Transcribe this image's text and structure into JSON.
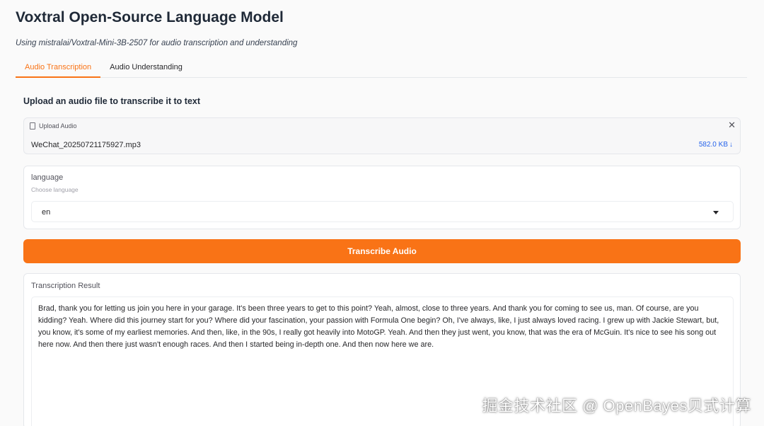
{
  "header": {
    "title": "Voxtral Open-Source Language Model",
    "subtitle": "Using mistralai/Voxtral-Mini-3B-2507 for audio transcription and understanding"
  },
  "tabs": [
    {
      "label": "Audio Transcription",
      "active": true
    },
    {
      "label": "Audio Understanding",
      "active": false
    }
  ],
  "main": {
    "section_label": "Upload an audio file to transcribe it to text",
    "upload": {
      "label": "Upload Audio",
      "file_name": "WeChat_20250721175927.mp3",
      "file_size": "582.0 KB",
      "download_icon": "↓"
    },
    "language": {
      "label": "language",
      "info": "Choose language",
      "selected": "en"
    },
    "button_label": "Transcribe Audio",
    "result": {
      "label": "Transcription Result",
      "text": "Brad, thank you for letting us join you here in your garage. It's been three years to get to this point? Yeah, almost, close to three years. And thank you for coming to see us, man. Of course, are you kidding? Yeah. Where did this journey start for you? Where did your fascination, your passion with Formula One begin? Oh, I've always, like, I just always loved racing. I grew up with Jackie Stewart, but, you know, it's some of my earliest memories. And then, like, in the 90s, I really got heavily into MotoGP. Yeah. And then they just went, you know, that was the era of McGuin. It's nice to see his song out here now. And then there just wasn't enough races. And then I started being in-depth one. And then now here we are."
    }
  },
  "watermark": "掘金技术社区 @ OpenBayes贝式计算",
  "colors": {
    "accent": "#f97316",
    "link": "#2563eb",
    "background": "#fafafa"
  },
  "icons": {
    "file": "file-icon",
    "close": "close-icon",
    "caret": "chevron-down-icon",
    "download": "download-icon"
  }
}
